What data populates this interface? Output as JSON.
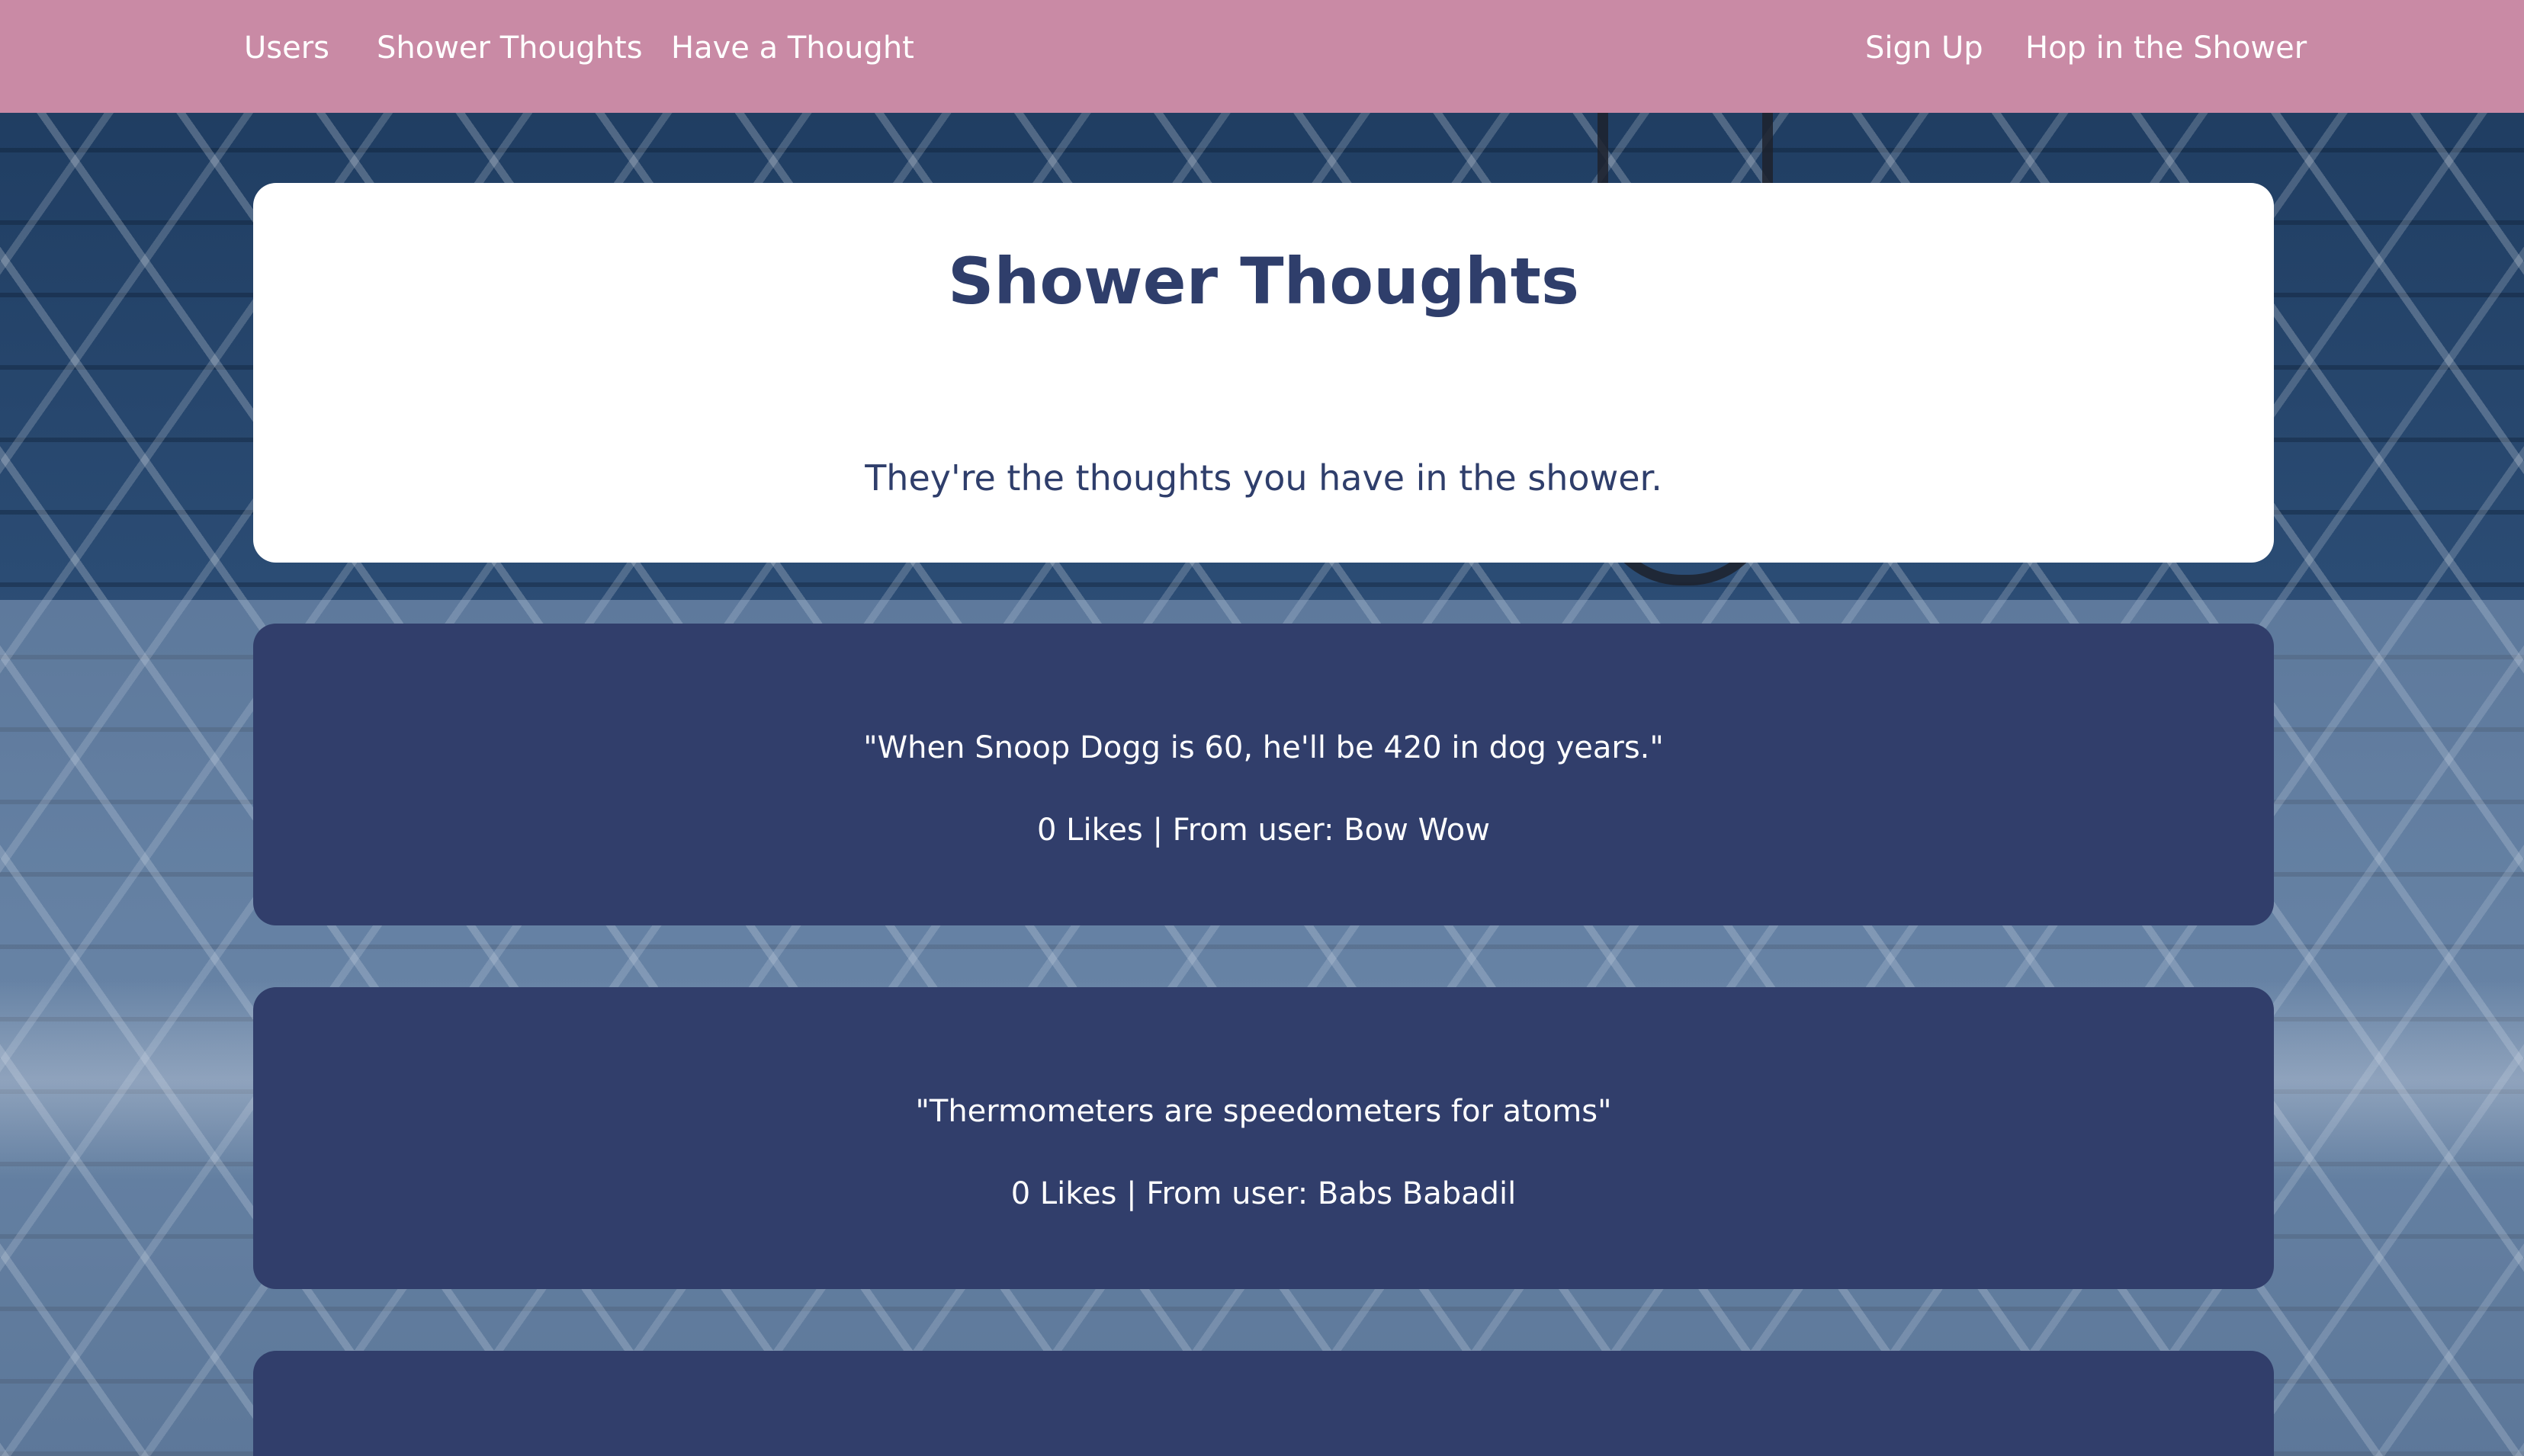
{
  "nav": {
    "left": [
      "Users",
      "Shower Thoughts",
      "Have a Thought"
    ],
    "right": [
      "Sign Up",
      "Hop in the Shower"
    ]
  },
  "hero": {
    "title": "Shower Thoughts",
    "subtitle": "They're the thoughts you have in the shower."
  },
  "thoughts": [
    {
      "text": "\"When Snoop Dogg is 60, he'll be 420 in dog years.\"",
      "meta": "0 Likes | From user: Bow Wow"
    },
    {
      "text": "\"Thermometers are speedometers for atoms\"",
      "meta": "0 Likes | From user: Babs Babadil"
    }
  ],
  "colors": {
    "navbar": "#c98aa5",
    "card_dark": "#313e6b",
    "hero_text": "#2f3e6b",
    "hero_bg": "#ffffff"
  }
}
